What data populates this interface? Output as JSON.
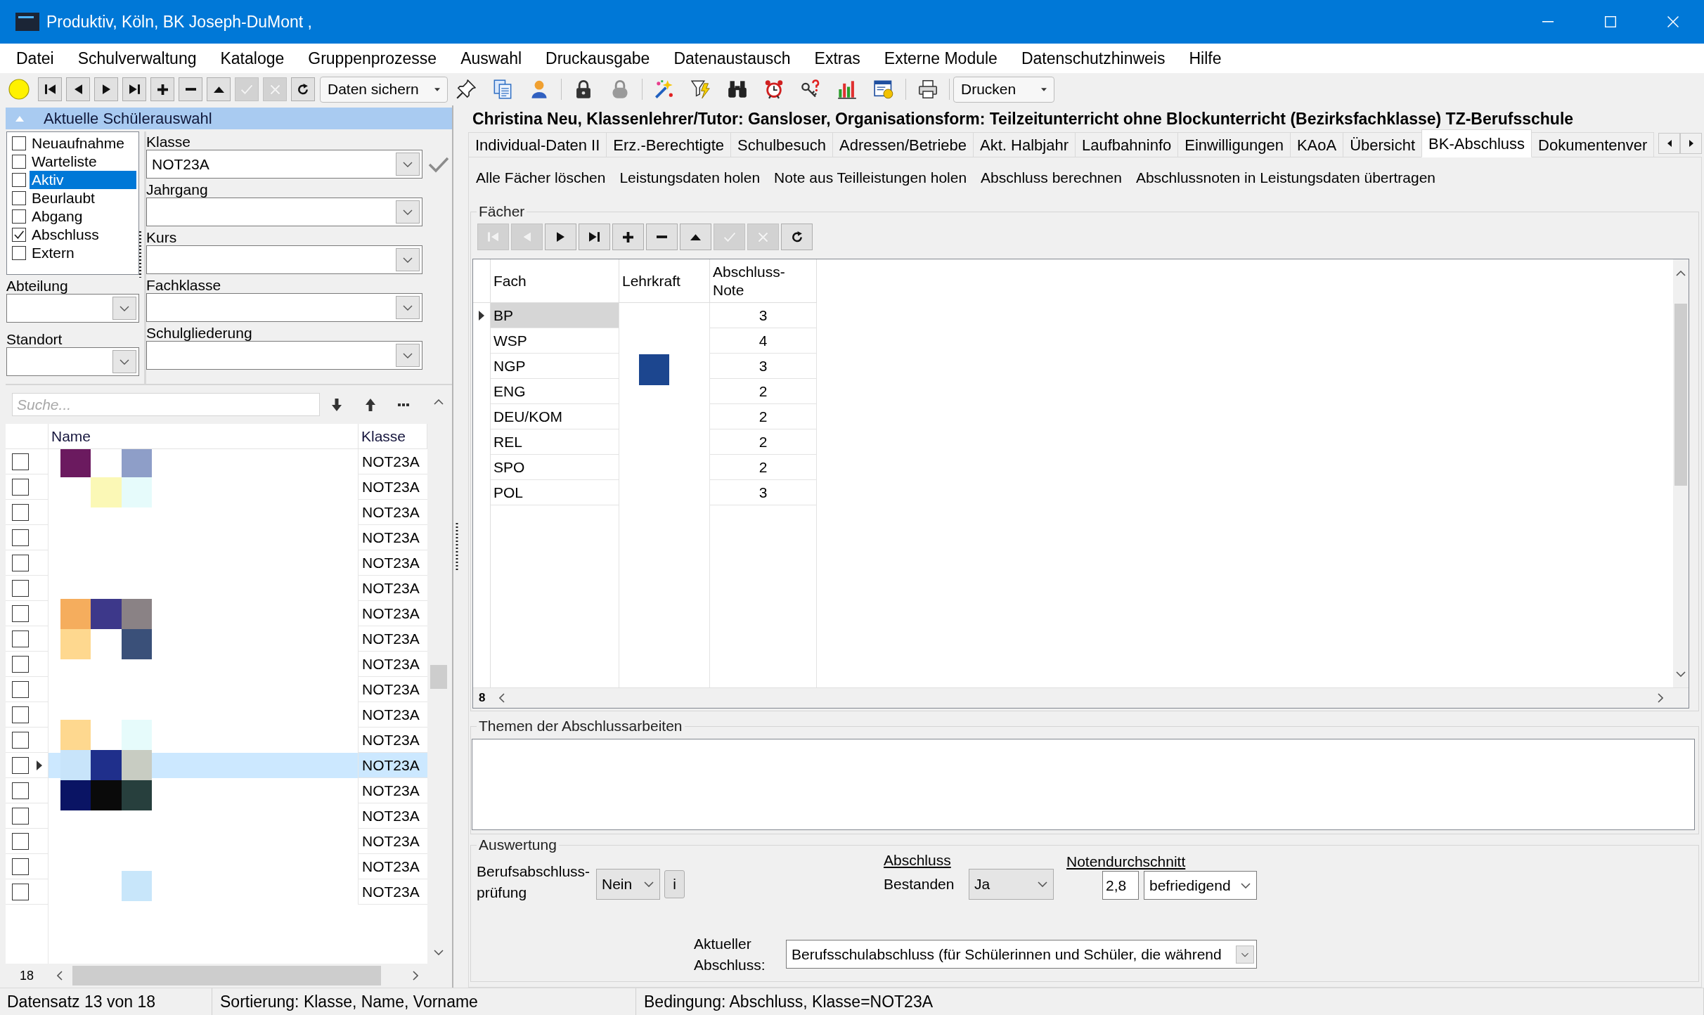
{
  "window": {
    "title": "Produktiv, Köln, BK Joseph-DuMont ,"
  },
  "menu": [
    "Datei",
    "Schulverwaltung",
    "Kataloge",
    "Gruppenprozesse",
    "Auswahl",
    "Druckausgabe",
    "Datenaustausch",
    "Extras",
    "Externe Module",
    "Datenschutzhinweis",
    "Hilfe"
  ],
  "toolbar": {
    "navigator": [
      {
        "kind": "first",
        "disabled": false
      },
      {
        "kind": "prior",
        "disabled": false
      },
      {
        "kind": "next",
        "disabled": false
      },
      {
        "kind": "last",
        "disabled": false
      },
      {
        "kind": "insert",
        "disabled": false
      },
      {
        "kind": "delete",
        "disabled": false
      },
      {
        "kind": "edit",
        "disabled": false
      },
      {
        "kind": "post",
        "disabled": true
      },
      {
        "kind": "cancel",
        "disabled": true
      },
      {
        "kind": "refresh",
        "disabled": false
      }
    ],
    "save_menu": {
      "label": "Daten sichern"
    },
    "print_menu": {
      "label": "Drucken"
    }
  },
  "selection_panel": {
    "title": "Aktuelle Schülerauswahl",
    "status_filters": [
      {
        "label": "Neuaufnahme",
        "checked": false,
        "selected": false
      },
      {
        "label": "Warteliste",
        "checked": false,
        "selected": false
      },
      {
        "label": "Aktiv",
        "checked": false,
        "selected": true
      },
      {
        "label": "Beurlaubt",
        "checked": false,
        "selected": false
      },
      {
        "label": "Abgang",
        "checked": false,
        "selected": false
      },
      {
        "label": "Abschluss",
        "checked": true,
        "selected": false
      },
      {
        "label": "Extern",
        "checked": false,
        "selected": false
      }
    ],
    "left_fields": [
      {
        "label": "Abteilung"
      },
      {
        "label": "Standort"
      }
    ],
    "right_fields": [
      {
        "label": "Klasse",
        "value": "NOT23A"
      },
      {
        "label": "Jahrgang"
      },
      {
        "label": "Kurs"
      },
      {
        "label": "Fachklasse"
      },
      {
        "label": "Schulgliederung"
      }
    ]
  },
  "student_list": {
    "search": {
      "placeholder": "Suche..."
    },
    "columns": [
      "Name",
      "Klasse"
    ],
    "rows": [
      {
        "checked": false,
        "selected": false,
        "klasse": "NOT23A"
      },
      {
        "checked": false,
        "selected": false,
        "klasse": "NOT23A"
      },
      {
        "checked": false,
        "selected": false,
        "klasse": "NOT23A"
      },
      {
        "checked": false,
        "selected": false,
        "klasse": "NOT23A"
      },
      {
        "checked": false,
        "selected": false,
        "klasse": "NOT23A"
      },
      {
        "checked": false,
        "selected": false,
        "klasse": "NOT23A"
      },
      {
        "checked": false,
        "selected": false,
        "klasse": "NOT23A"
      },
      {
        "checked": false,
        "selected": false,
        "klasse": "NOT23A"
      },
      {
        "checked": false,
        "selected": false,
        "klasse": "NOT23A"
      },
      {
        "checked": false,
        "selected": false,
        "klasse": "NOT23A"
      },
      {
        "checked": false,
        "selected": false,
        "klasse": "NOT23A"
      },
      {
        "checked": false,
        "selected": false,
        "klasse": "NOT23A"
      },
      {
        "checked": false,
        "selected": true,
        "klasse": "NOT23A"
      },
      {
        "checked": false,
        "selected": false,
        "klasse": "NOT23A"
      },
      {
        "checked": false,
        "selected": false,
        "klasse": "NOT23A"
      },
      {
        "checked": false,
        "selected": false,
        "klasse": "NOT23A"
      },
      {
        "checked": false,
        "selected": false,
        "klasse": "NOT23A"
      },
      {
        "checked": false,
        "selected": false,
        "klasse": "NOT23A"
      }
    ],
    "count": "18"
  },
  "detail": {
    "header": "Christina Neu, Klassenlehrer/Tutor: Gansloser, Organisationsform: Teilzeitunterricht ohne Blockunterricht (Bezirksfachklasse) TZ-Berufsschule",
    "tabs": [
      {
        "label": "Individual-Daten II",
        "selected": false
      },
      {
        "label": "Erz.-Berechtigte",
        "selected": false
      },
      {
        "label": "Schulbesuch",
        "selected": false
      },
      {
        "label": "Adressen/Betriebe",
        "selected": false
      },
      {
        "label": "Akt. Halbjahr",
        "selected": false
      },
      {
        "label": "Laufbahninfo",
        "selected": false
      },
      {
        "label": "Einwilligungen",
        "selected": false
      },
      {
        "label": "KAoA",
        "selected": false
      },
      {
        "label": "Übersicht",
        "selected": false
      },
      {
        "label": "BK-Abschluss",
        "selected": true
      },
      {
        "label": "Dokumentenver",
        "selected": false
      }
    ],
    "actions": [
      "Alle Fächer löschen",
      "Leistungsdaten holen",
      "Note aus Teilleistungen holen",
      "Abschluss berechnen",
      "Abschlussnoten in Leistungsdaten übertragen"
    ],
    "subjects": {
      "title": "Fächer",
      "navigator": [
        {
          "kind": "first",
          "disabled": true
        },
        {
          "kind": "prior",
          "disabled": true
        },
        {
          "kind": "next",
          "disabled": false
        },
        {
          "kind": "last",
          "disabled": false
        },
        {
          "kind": "insert",
          "disabled": false
        },
        {
          "kind": "delete",
          "disabled": false
        },
        {
          "kind": "edit",
          "disabled": false
        },
        {
          "kind": "post",
          "disabled": true
        },
        {
          "kind": "cancel",
          "disabled": true
        },
        {
          "kind": "refresh",
          "disabled": false
        }
      ],
      "columns": [
        "Fach",
        "Lehrkraft",
        "Abschluss-Note"
      ],
      "rows": [
        {
          "fach": "BP",
          "note": "3",
          "selected": true
        },
        {
          "fach": "WSP",
          "note": "4",
          "selected": false
        },
        {
          "fach": "NGP",
          "note": "3",
          "selected": false
        },
        {
          "fach": "ENG",
          "note": "2",
          "selected": false
        },
        {
          "fach": "DEU/KOM",
          "note": "2",
          "selected": false
        },
        {
          "fach": "REL",
          "note": "2",
          "selected": false
        },
        {
          "fach": "SPO",
          "note": "2",
          "selected": false
        },
        {
          "fach": "POL",
          "note": "3",
          "selected": false
        }
      ],
      "count": "8"
    },
    "topics": {
      "title": "Themen der Abschlussarbeiten"
    },
    "evaluation": {
      "title": "Auswertung",
      "exam": {
        "label": "Berufsabschluss-prüfung",
        "value": "Nein",
        "info": "i"
      },
      "result": {
        "heading": "Abschluss",
        "label": "Bestanden",
        "value": "Ja"
      },
      "average": {
        "heading": "Notendurchschnitt",
        "value": "2,8",
        "grade": "befriedigend"
      },
      "current": {
        "label": "Aktueller Abschluss:",
        "value": "Berufsschulabschluss (für Schülerinnen und Schüler, die während"
      }
    }
  },
  "status_bar": [
    "Datensatz 13 von 18",
    "Sortierung: Klasse, Name, Vorname",
    "Bedingung: Abschluss, Klasse=NOT23A"
  ]
}
